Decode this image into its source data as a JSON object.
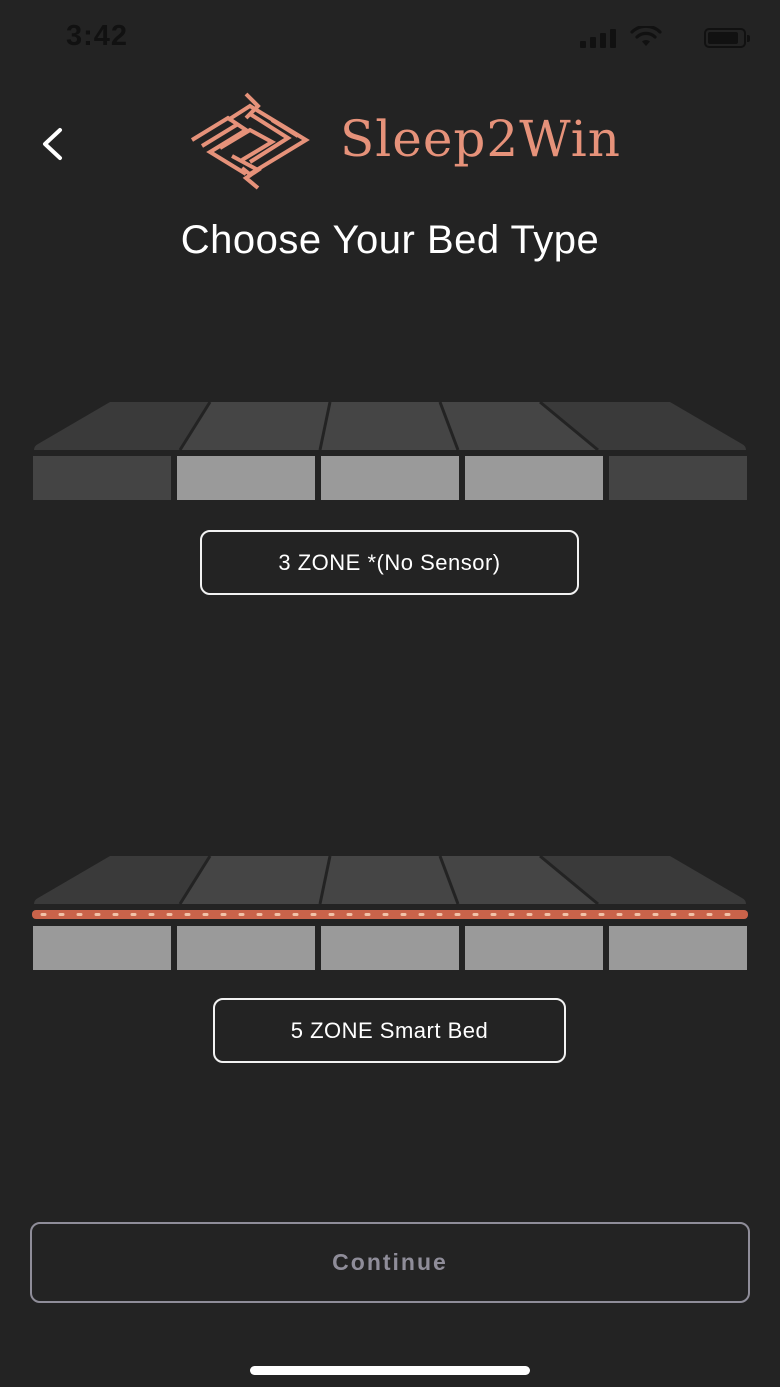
{
  "status_bar": {
    "time": "3:42"
  },
  "header": {
    "brand_name": "Sleep2Win",
    "title": "Choose Your Bed Type"
  },
  "bed_options": [
    {
      "label": "3 ZONE *(No Sensor)"
    },
    {
      "label": "5 ZONE Smart Bed"
    }
  ],
  "footer": {
    "continue_label": "Continue"
  },
  "colors": {
    "background": "#232323",
    "brand": "#e6927a",
    "zone_active": "#9a9a9a",
    "zone_inactive": "#444444",
    "continue_disabled": "#8f8d99"
  }
}
